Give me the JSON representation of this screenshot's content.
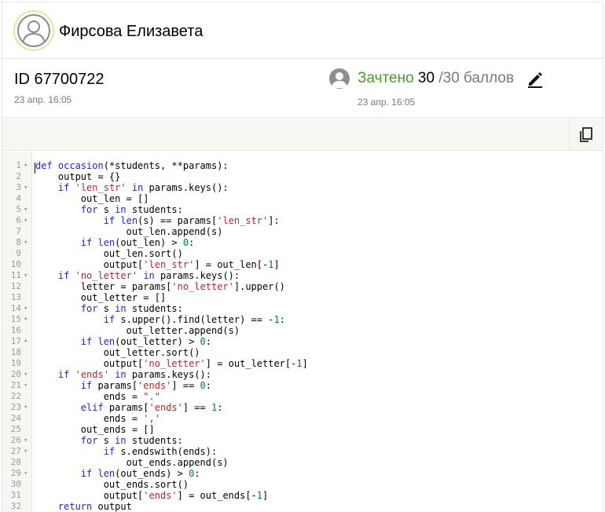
{
  "header": {
    "student_name": "Фирсова Елизавета"
  },
  "submission": {
    "id_label": "ID 67700722",
    "timestamp": "23 апр. 16:05"
  },
  "grade": {
    "status": "Зачтено",
    "score": "30",
    "max_text": "/30 баллов",
    "timestamp": "23 апр. 16:05"
  },
  "toolbar": {
    "copy_icon": "copy-icon"
  },
  "code": {
    "lines": [
      [
        {
          "t": "def ",
          "c": "kw"
        },
        {
          "t": "occasion",
          "c": "kw"
        },
        {
          "t": "(*students, **params):",
          "c": ""
        }
      ],
      [
        {
          "t": "    output = {}",
          "c": ""
        }
      ],
      [
        {
          "t": "    ",
          "c": ""
        },
        {
          "t": "if",
          "c": "kw"
        },
        {
          "t": " ",
          "c": ""
        },
        {
          "t": "'len_str'",
          "c": "str"
        },
        {
          "t": " ",
          "c": ""
        },
        {
          "t": "in",
          "c": "kw"
        },
        {
          "t": " params.keys():",
          "c": ""
        }
      ],
      [
        {
          "t": "        out_len = []",
          "c": ""
        }
      ],
      [
        {
          "t": "        ",
          "c": ""
        },
        {
          "t": "for",
          "c": "kw"
        },
        {
          "t": " s ",
          "c": ""
        },
        {
          "t": "in",
          "c": "kw"
        },
        {
          "t": " students:",
          "c": ""
        }
      ],
      [
        {
          "t": "            ",
          "c": ""
        },
        {
          "t": "if",
          "c": "kw"
        },
        {
          "t": " ",
          "c": ""
        },
        {
          "t": "len",
          "c": "kw"
        },
        {
          "t": "(s) == params[",
          "c": ""
        },
        {
          "t": "'len_str'",
          "c": "str"
        },
        {
          "t": "]:",
          "c": ""
        }
      ],
      [
        {
          "t": "                out_len.append(s)",
          "c": ""
        }
      ],
      [
        {
          "t": "        ",
          "c": ""
        },
        {
          "t": "if",
          "c": "kw"
        },
        {
          "t": " ",
          "c": ""
        },
        {
          "t": "len",
          "c": "kw"
        },
        {
          "t": "(out_len) > ",
          "c": ""
        },
        {
          "t": "0",
          "c": "num"
        },
        {
          "t": ":",
          "c": ""
        }
      ],
      [
        {
          "t": "            out_len.sort()",
          "c": ""
        }
      ],
      [
        {
          "t": "            output[",
          "c": ""
        },
        {
          "t": "'len_str'",
          "c": "str"
        },
        {
          "t": "] = out_len[-",
          "c": ""
        },
        {
          "t": "1",
          "c": "num"
        },
        {
          "t": "]",
          "c": ""
        }
      ],
      [
        {
          "t": "    ",
          "c": ""
        },
        {
          "t": "if",
          "c": "kw"
        },
        {
          "t": " ",
          "c": ""
        },
        {
          "t": "'no_letter'",
          "c": "str"
        },
        {
          "t": " ",
          "c": ""
        },
        {
          "t": "in",
          "c": "kw"
        },
        {
          "t": " params.keys():",
          "c": ""
        }
      ],
      [
        {
          "t": "        letter = params[",
          "c": ""
        },
        {
          "t": "'no_letter'",
          "c": "str"
        },
        {
          "t": "].upper()",
          "c": ""
        }
      ],
      [
        {
          "t": "        out_letter = []",
          "c": ""
        }
      ],
      [
        {
          "t": "        ",
          "c": ""
        },
        {
          "t": "for",
          "c": "kw"
        },
        {
          "t": " s ",
          "c": ""
        },
        {
          "t": "in",
          "c": "kw"
        },
        {
          "t": " students:",
          "c": ""
        }
      ],
      [
        {
          "t": "            ",
          "c": ""
        },
        {
          "t": "if",
          "c": "kw"
        },
        {
          "t": " s.upper().find(letter) == -",
          "c": ""
        },
        {
          "t": "1",
          "c": "num"
        },
        {
          "t": ":",
          "c": ""
        }
      ],
      [
        {
          "t": "                out_letter.append(s)",
          "c": ""
        }
      ],
      [
        {
          "t": "        ",
          "c": ""
        },
        {
          "t": "if",
          "c": "kw"
        },
        {
          "t": " ",
          "c": ""
        },
        {
          "t": "len",
          "c": "kw"
        },
        {
          "t": "(out_letter) > ",
          "c": ""
        },
        {
          "t": "0",
          "c": "num"
        },
        {
          "t": ":",
          "c": ""
        }
      ],
      [
        {
          "t": "            out_letter.sort()",
          "c": ""
        }
      ],
      [
        {
          "t": "            output[",
          "c": ""
        },
        {
          "t": "'no_letter'",
          "c": "str"
        },
        {
          "t": "] = out_letter[-",
          "c": ""
        },
        {
          "t": "1",
          "c": "num"
        },
        {
          "t": "]",
          "c": ""
        }
      ],
      [
        {
          "t": "    ",
          "c": ""
        },
        {
          "t": "if",
          "c": "kw"
        },
        {
          "t": " ",
          "c": ""
        },
        {
          "t": "'ends'",
          "c": "str"
        },
        {
          "t": " ",
          "c": ""
        },
        {
          "t": "in",
          "c": "kw"
        },
        {
          "t": " params.keys():",
          "c": ""
        }
      ],
      [
        {
          "t": "        ",
          "c": ""
        },
        {
          "t": "if",
          "c": "kw"
        },
        {
          "t": " params[",
          "c": ""
        },
        {
          "t": "'ends'",
          "c": "str"
        },
        {
          "t": "] == ",
          "c": ""
        },
        {
          "t": "0",
          "c": "num"
        },
        {
          "t": ":",
          "c": ""
        }
      ],
      [
        {
          "t": "            ends = ",
          "c": ""
        },
        {
          "t": "\".\"",
          "c": "str"
        }
      ],
      [
        {
          "t": "        ",
          "c": ""
        },
        {
          "t": "elif",
          "c": "kw"
        },
        {
          "t": " params[",
          "c": ""
        },
        {
          "t": "'ends'",
          "c": "str"
        },
        {
          "t": "] == ",
          "c": ""
        },
        {
          "t": "1",
          "c": "num"
        },
        {
          "t": ":",
          "c": ""
        }
      ],
      [
        {
          "t": "            ends = ",
          "c": ""
        },
        {
          "t": "','",
          "c": "str"
        }
      ],
      [
        {
          "t": "        out_ends = []",
          "c": ""
        }
      ],
      [
        {
          "t": "        ",
          "c": ""
        },
        {
          "t": "for",
          "c": "kw"
        },
        {
          "t": " s ",
          "c": ""
        },
        {
          "t": "in",
          "c": "kw"
        },
        {
          "t": " students:",
          "c": ""
        }
      ],
      [
        {
          "t": "            ",
          "c": ""
        },
        {
          "t": "if",
          "c": "kw"
        },
        {
          "t": " s.endswith(ends):",
          "c": ""
        }
      ],
      [
        {
          "t": "                out_ends.append(s)",
          "c": ""
        }
      ],
      [
        {
          "t": "        ",
          "c": ""
        },
        {
          "t": "if",
          "c": "kw"
        },
        {
          "t": " ",
          "c": ""
        },
        {
          "t": "len",
          "c": "kw"
        },
        {
          "t": "(out_ends) > ",
          "c": ""
        },
        {
          "t": "0",
          "c": "num"
        },
        {
          "t": ":",
          "c": ""
        }
      ],
      [
        {
          "t": "            out_ends.sort()",
          "c": ""
        }
      ],
      [
        {
          "t": "            output[",
          "c": ""
        },
        {
          "t": "'ends'",
          "c": "str"
        },
        {
          "t": "] = out_ends[-",
          "c": ""
        },
        {
          "t": "1",
          "c": "num"
        },
        {
          "t": "]",
          "c": ""
        }
      ],
      [
        {
          "t": "    ",
          "c": ""
        },
        {
          "t": "return",
          "c": "kw"
        },
        {
          "t": " output",
          "c": ""
        }
      ]
    ],
    "foldable_lines": [
      1,
      3,
      5,
      6,
      8,
      11,
      14,
      15,
      17,
      20,
      21,
      23,
      26,
      27,
      29
    ]
  }
}
